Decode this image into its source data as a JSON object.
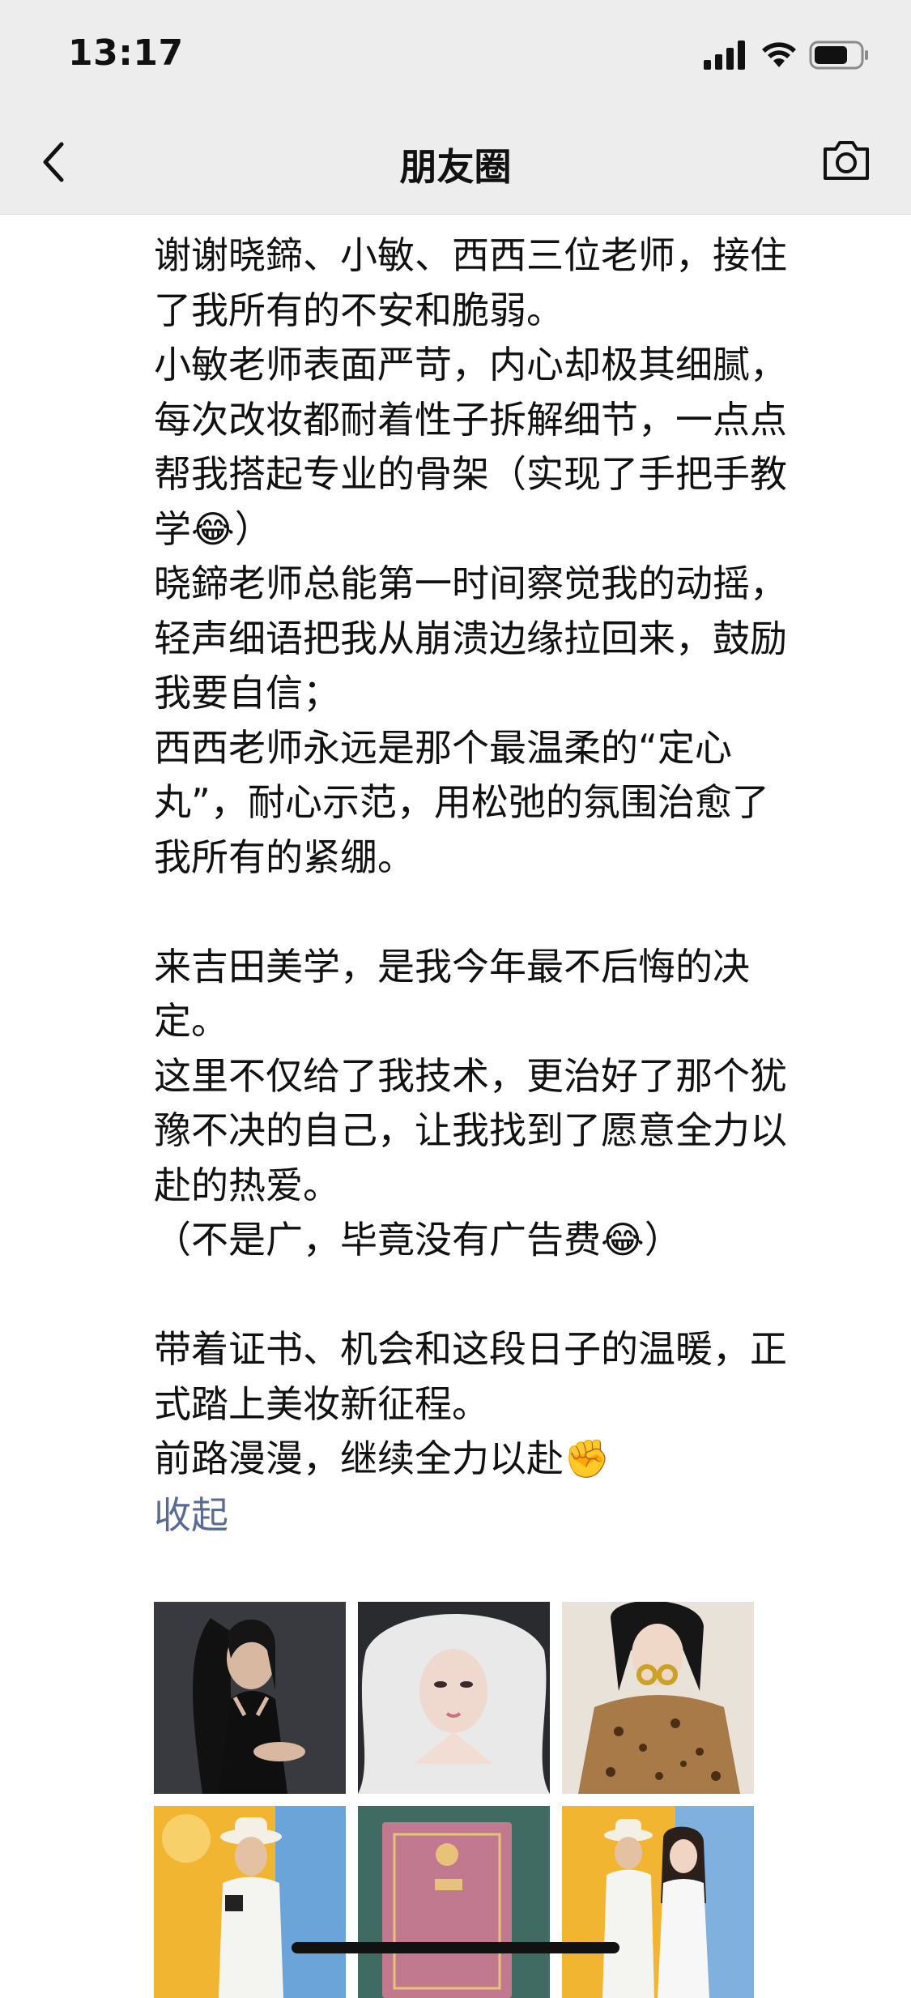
{
  "status_bar": {
    "time": "13:17",
    "icons": [
      "signal-icon",
      "wifi-icon",
      "battery-icon"
    ]
  },
  "nav": {
    "title": "朋友圈",
    "back_icon": "chevron-left-icon",
    "camera_icon": "camera-icon"
  },
  "post": {
    "text": "谢谢晓鍗、小敏、西西三位老师，接住\n了我所有的不安和脆弱。\n小敏老师表面严苛，内心却极其细腻，\n每次改妆都耐着性子拆解细节，一点点\n帮我搭起专业的骨架（实现了手把手教\n学😂）\n晓鍗老师总能第一时间察觉我的动摇，\n轻声细语把我从崩溃边缘拉回来，鼓励\n我要自信；\n西西老师永远是那个最温柔的“定心\n丸”，耐心示范，用松弛的氛围治愈了\n我所有的紧绷。\n\n来吉田美学，是我今年最不后悔的决\n定。\n这里不仅给了我技术，更治好了那个犹\n豫不决的自己，让我找到了愿意全力以\n赴的热爱。\n（不是广，毕竟没有广告费😂）\n\n带着证书、机会和这段日子的温暖，正\n式踏上美妆新征程。\n前路漫漫，继续全力以赴✊",
    "collapse_label": "收起"
  },
  "photos": {
    "images": [
      "photo-woman-black-dress",
      "photo-woman-white-veil",
      "photo-woman-leopard-print",
      "photo-man-stage-certificate",
      "photo-certificate-books",
      "photo-couple-stage"
    ]
  },
  "colors": {
    "bar_bg": "#ededed",
    "link": "#576b95",
    "text": "#111111"
  }
}
